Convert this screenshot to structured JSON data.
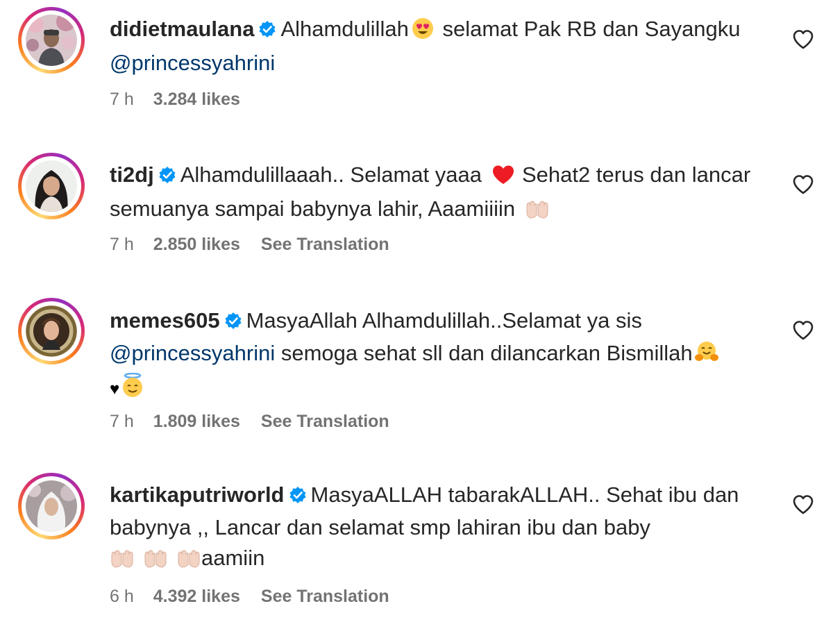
{
  "colors": {
    "text": "#262626",
    "meta": "#737373",
    "mention": "#00376b",
    "verified": "#0095f6",
    "red_heart": "#ed1c24"
  },
  "comments": [
    {
      "username": "didietmaulana",
      "text_parts": [
        "Alhamdulillah",
        "selamat Pak RB dan Sayangku",
        "@princessyahrini"
      ],
      "emojis": [
        "heart-eyes-emoji"
      ],
      "time": "7 h",
      "likes": "3.284 likes",
      "translation": ""
    },
    {
      "username": "ti2dj",
      "text_parts": [
        "Alhamdulillaaah.. Selamat yaaa",
        "Sehat2 terus dan lancar semuanya sampai babynya lahir, Aaamiiiin"
      ],
      "emojis": [
        "red-heart-emoji",
        "palms-up-emoji"
      ],
      "time": "7 h",
      "likes": "2.850 likes",
      "translation": "See Translation"
    },
    {
      "username": "memes605",
      "text_parts": [
        "MasyaAllah Alhamdulillah..Selamat ya sis",
        "@princessyahrini",
        "semoga sehat sll dan dilancarkan Bismillah",
        "♥"
      ],
      "emojis": [
        "hugging-face-emoji",
        "black-heart-emoji",
        "halo-face-emoji"
      ],
      "time": "7 h",
      "likes": "1.809 likes",
      "translation": "See Translation"
    },
    {
      "username": "kartikaputriworld",
      "text_parts": [
        "MasyaALLAH tabarakALLAH.. Sehat ibu dan babynya ,, Lancar dan selamat smp lahiran ibu dan baby",
        "aamiin"
      ],
      "emojis": [
        "palms-up-emoji",
        "palms-up-emoji",
        "palms-up-emoji"
      ],
      "time": "6 h",
      "likes": "4.392 likes",
      "translation": "See Translation"
    }
  ]
}
